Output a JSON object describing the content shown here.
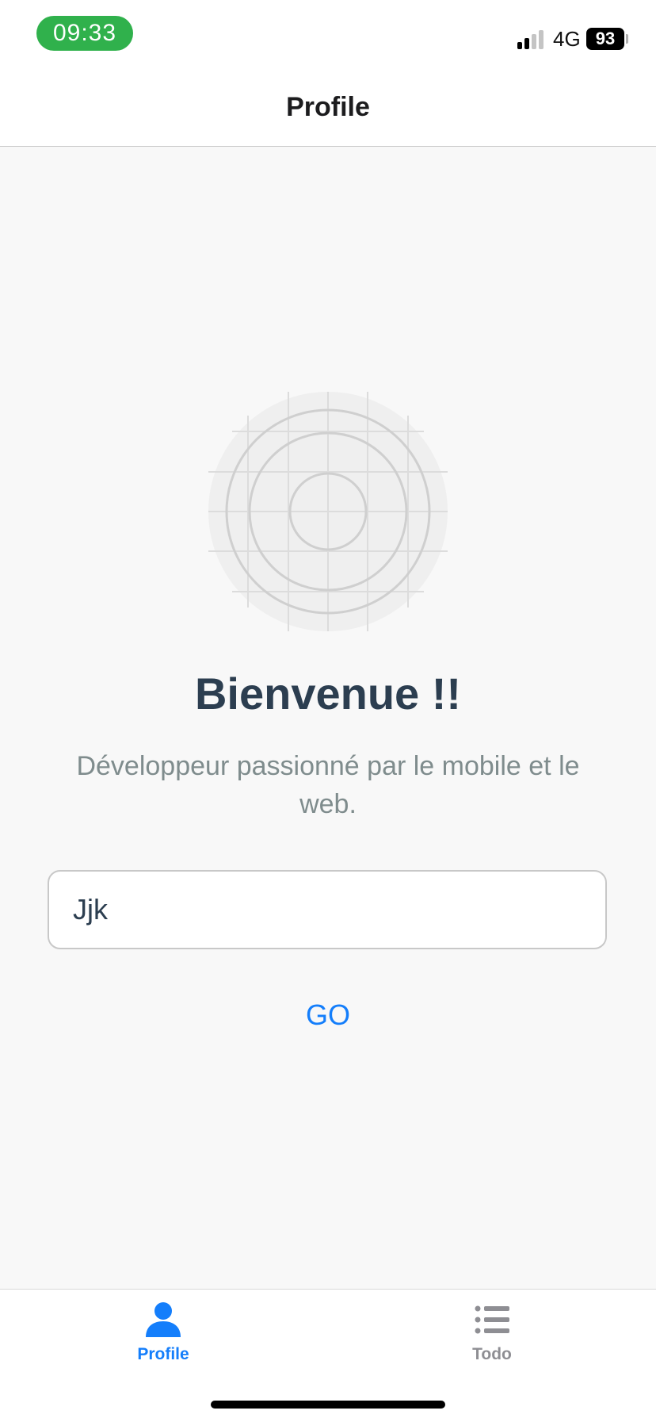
{
  "status_bar": {
    "time": "09:33",
    "network": "4G",
    "battery": "93",
    "time_pill_color": "#30b14c"
  },
  "header": {
    "title": "Profile"
  },
  "profile": {
    "avatar_icon": "placeholder-grid-icon",
    "title": "Bienvenue !!",
    "subtitle": "Développeur passionné par le mobile et le web."
  },
  "form": {
    "name_value": "Jjk",
    "go_label": "GO"
  },
  "tabs": [
    {
      "label": "Profile",
      "icon": "person-icon",
      "active": true,
      "color": "#147efb"
    },
    {
      "label": "Todo",
      "icon": "list-icon",
      "active": false,
      "color": "#8e8e93"
    }
  ],
  "colors": {
    "accent": "#147efb",
    "title": "#2c3e50",
    "subtitle": "#7f8c8d"
  }
}
